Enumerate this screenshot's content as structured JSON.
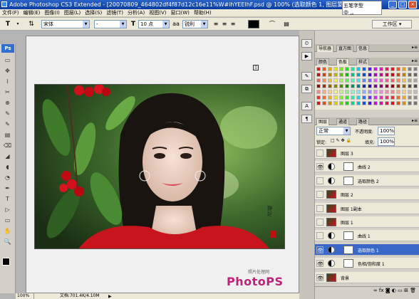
{
  "title": {
    "text": "Adobe Photoshop CS3 Extended - [20070809_464802df4f87d12c16e11%W#ihYEElhF.psd @ 100% (选取颜色 1, 图层蒙版/8)]",
    "minimize": "_",
    "maximize": "□",
    "close": "×"
  },
  "ime": {
    "line1": "五笔字型",
    "line2": "中 ,。"
  },
  "menu": [
    "文件(F)",
    "编辑(E)",
    "图像(I)",
    "图层(L)",
    "选择(S)",
    "滤镜(T)",
    "分析(A)",
    "视图(V)",
    "窗口(W)",
    "帮助(H)"
  ],
  "options": {
    "font_family": "宋体",
    "font_style": "-",
    "size_icon_text": "T",
    "font_size": "10 点",
    "aa_label": "aa",
    "antialias": "锐利",
    "workspace": "工作区 ▾"
  },
  "toolbox": {
    "logo": "Ps"
  },
  "canvas": {
    "watermark_line1": "照片处理网",
    "watermark_main": "PhotoPS",
    "signature": "静好"
  },
  "status": {
    "zoom": "100%",
    "doc": "文档:701.4K/4.10M"
  },
  "colors": {
    "accent": "#3a68c8",
    "titlebar": "#0a3c9e",
    "background": "#b4b4b4"
  },
  "panels": {
    "nav_tabs": [
      "导航器",
      "直方图",
      "信息"
    ],
    "color_tabs": [
      "颜色",
      "色板",
      "样式"
    ],
    "layers_tabs": [
      "图层",
      "通道",
      "路径"
    ],
    "blend_mode": "正常",
    "opacity_label": "不透明度:",
    "opacity": "100%",
    "lock_label": "锁定:",
    "fill_label": "填充:",
    "fill": "100%"
  },
  "layers": [
    {
      "name": "图层 3",
      "type": "pixel",
      "visible": false
    },
    {
      "name": "曲线 2",
      "type": "adjust",
      "visible": true
    },
    {
      "name": "选取颜色 2",
      "type": "adjust",
      "visible": false
    },
    {
      "name": "图层 2",
      "type": "pixel",
      "visible": false
    },
    {
      "name": "图层 1副本",
      "type": "pixel",
      "visible": false
    },
    {
      "name": "图层 1",
      "type": "pixel",
      "visible": false
    },
    {
      "name": "曲线 1",
      "type": "adjust",
      "visible": false
    },
    {
      "name": "选取颜色 1",
      "type": "adjust",
      "visible": true,
      "selected": true
    },
    {
      "name": "色相/饱和度 1",
      "type": "adjust",
      "visible": true
    },
    {
      "name": "背景",
      "type": "pixel",
      "visible": true
    }
  ]
}
